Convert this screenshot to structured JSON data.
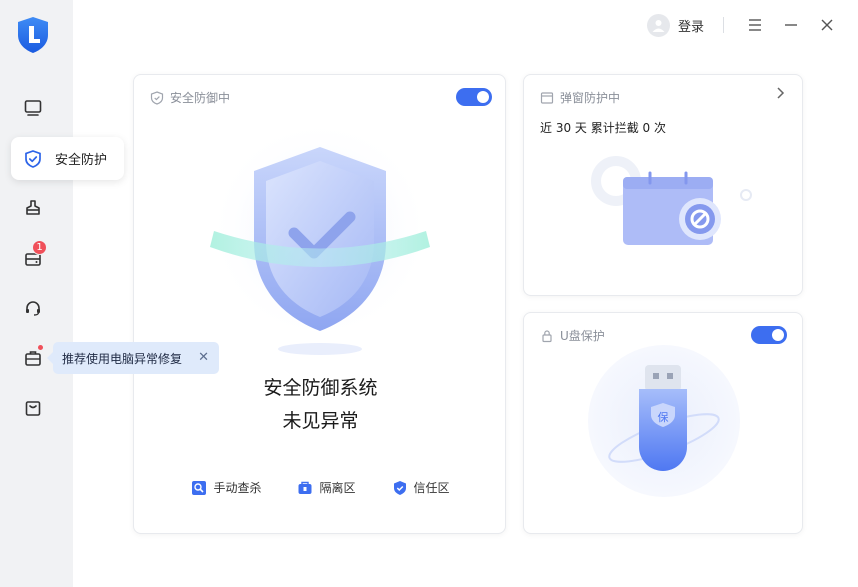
{
  "colors": {
    "accent": "#3d6ef0",
    "sidebar_bg": "#f1f2f4",
    "badge_red": "#f0505a"
  },
  "sidebar": {
    "items": [
      {
        "icon": "monitor-icon"
      },
      {
        "icon": "shield-check-icon",
        "label": "安全防护"
      },
      {
        "icon": "broom-icon"
      },
      {
        "icon": "toolbox-icon",
        "badge": "1"
      },
      {
        "icon": "headset-icon"
      },
      {
        "icon": "briefcase-icon"
      },
      {
        "icon": "bag-icon"
      }
    ],
    "tooltip": "推荐使用电脑异常修复"
  },
  "topbar": {
    "login_label": "登录"
  },
  "main_card": {
    "header_label": "安全防御中",
    "toggle_on": true,
    "status_line1": "安全防御系统",
    "status_line2": "未见异常",
    "links": [
      "手动查杀",
      "隔离区",
      "信任区"
    ]
  },
  "popup_card": {
    "header_label": "弹窗防护中",
    "count_text": "近 30 天 累计拦截 0 次"
  },
  "usb_card": {
    "header_label": "U盘保护",
    "toggle_on": true,
    "usb_label": "保"
  }
}
